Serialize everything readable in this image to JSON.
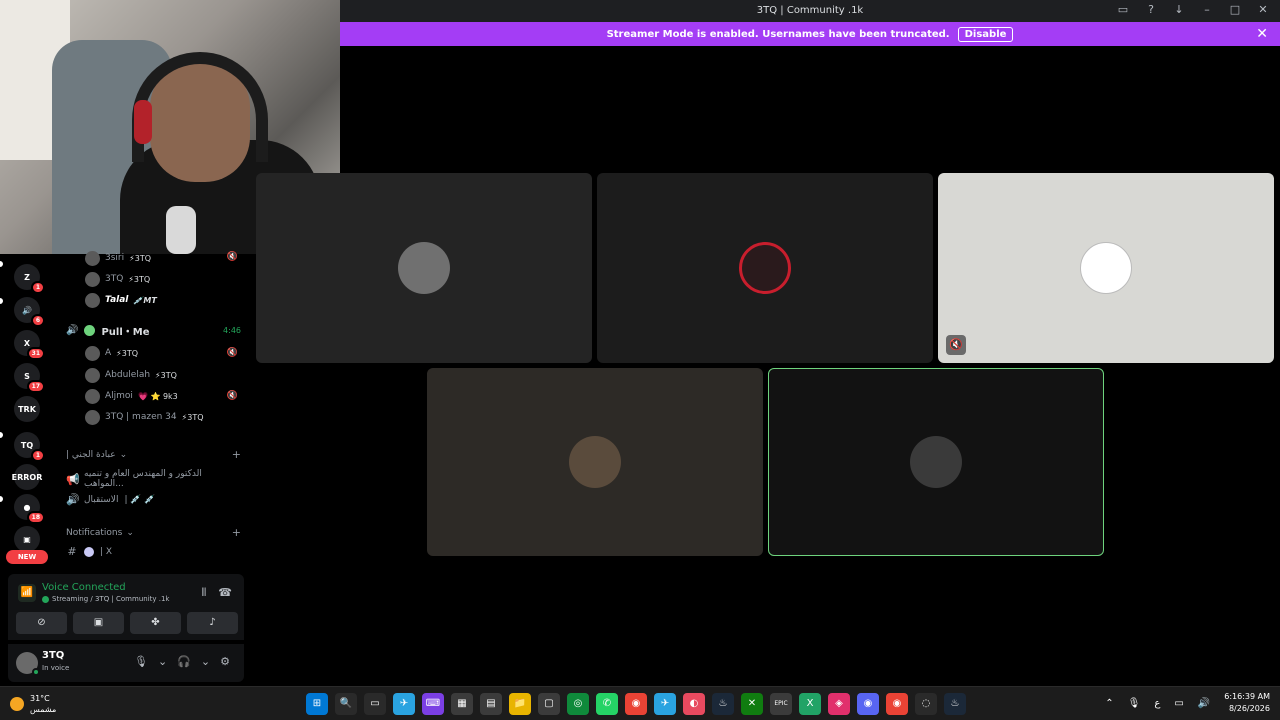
{
  "window": {
    "title": "3TQ | Community .1k"
  },
  "banner": {
    "text": "Streamer Mode is enabled. Usernames have been truncated.",
    "disable_label": "Disable"
  },
  "rail": {
    "servers": [
      {
        "label": "Z",
        "badge": "1",
        "color": "#1e1f22"
      },
      {
        "label": "🔊",
        "badge": "6",
        "color": "#2a6bd0"
      },
      {
        "label": "X",
        "badge": "31",
        "color": "#2b0d10"
      },
      {
        "label": "S",
        "badge": "17",
        "color": "#1d5fd6"
      },
      {
        "label": "TRK",
        "badge": "",
        "color": "#0f2a44"
      },
      {
        "label": "TQ",
        "badge": "1",
        "color": "#1e1f22"
      },
      {
        "label": "ERROR",
        "badge": "",
        "color": "#000000"
      },
      {
        "label": "●",
        "badge": "18",
        "color": "#1e1f22"
      },
      {
        "label": "▣",
        "badge": "",
        "color": "#1e1f22"
      }
    ],
    "new_label": "NEW"
  },
  "sidebar": {
    "top_users": [
      {
        "name": "3siri",
        "tag": "⚡3TQ"
      },
      {
        "name": "3TQ",
        "tag": "⚡3TQ"
      },
      {
        "name": "Talal",
        "tag": "💉MT"
      }
    ],
    "voice_channel": {
      "name": "Pull・Me",
      "timer": "4:46"
    },
    "channel_users": [
      {
        "name": "A",
        "tag": "⚡3TQ"
      },
      {
        "name": "Abdulelah",
        "tag": "⚡3TQ"
      },
      {
        "name": "Aljmoi",
        "tag": "💗 ⭐ 9k3"
      },
      {
        "name": "3TQ | mazen 34",
        "tag": "⚡3TQ"
      }
    ],
    "category1": "| عبادة الجني",
    "chan_text1": "الدكتور و المهندس العام و تنميه المواهب...",
    "chan_text2": "الاستقبال",
    "chan_text2_emoji": "| 💉 💉",
    "category2": "Notifications",
    "chan_text3": "| X"
  },
  "voice_panel": {
    "status": "Voice Connected",
    "streaming": "Streaming / 3TQ | Community .1k"
  },
  "user_panel": {
    "name": "3TQ",
    "status": "In voice"
  },
  "tiles": [
    {
      "bg": "#242424",
      "avatar": "#707070"
    },
    {
      "bg": "#1c1c1c",
      "avatar": "#c81e2d"
    },
    {
      "bg": "#d8d8d4",
      "avatar": "#ffffff"
    },
    {
      "bg": "#2d2a26",
      "avatar": "#5a4b3c"
    },
    {
      "bg": "#121212",
      "avatar": "#3a3a3a"
    }
  ],
  "taskbar": {
    "weather_temp": "31°C",
    "weather_desc": "مشمس",
    "apps": [
      "⊞",
      "🔍",
      "▭",
      "✈",
      "⌨",
      "▦",
      "▤",
      "📁",
      "▢",
      "◎",
      "✆",
      "◉",
      "✈",
      "◐",
      "♨",
      "✕",
      "EPIC",
      "X",
      "◈",
      "◉",
      "◉",
      "◌",
      "♨"
    ],
    "lang": "ع",
    "time": "6:16:39 AM",
    "date": "8/26/2026"
  }
}
